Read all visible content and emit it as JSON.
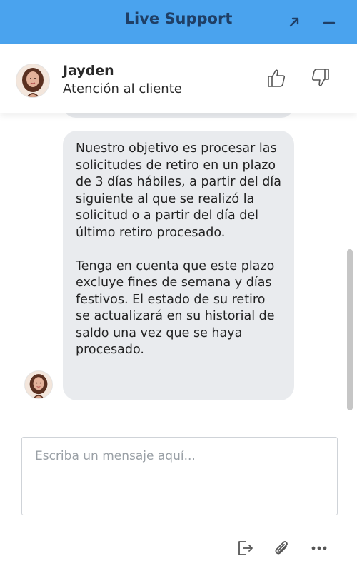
{
  "window": {
    "title": "Live Support",
    "accent_color": "#4aa3ee",
    "title_color": "#1f3f66"
  },
  "agent": {
    "name": "Jayden",
    "role": "Atención al cliente",
    "avatar_icon": "agent-avatar"
  },
  "conversation": {
    "message": {
      "paragraph_1": "Nuestro objetivo es procesar las solicitudes de retiro en un plazo de 3 días hábiles, a partir del día siguiente al que se realizó la solicitud o a partir del día del último retiro procesado.",
      "paragraph_2": "Tenga en cuenta que este plazo excluye fines de semana y días festivos. El estado de su retiro se actualizará en su historial de saldo una vez que se haya procesado."
    }
  },
  "composer": {
    "placeholder": "Escriba un mensaje aquí...",
    "value": ""
  },
  "icons": {
    "expand": "expand-arrow-icon",
    "minimize": "minimize-icon",
    "thumbs_up": "thumbs-up-icon",
    "thumbs_down": "thumbs-down-icon",
    "exit": "exit-chat-icon",
    "attach": "paperclip-icon",
    "more": "more-options-icon"
  }
}
